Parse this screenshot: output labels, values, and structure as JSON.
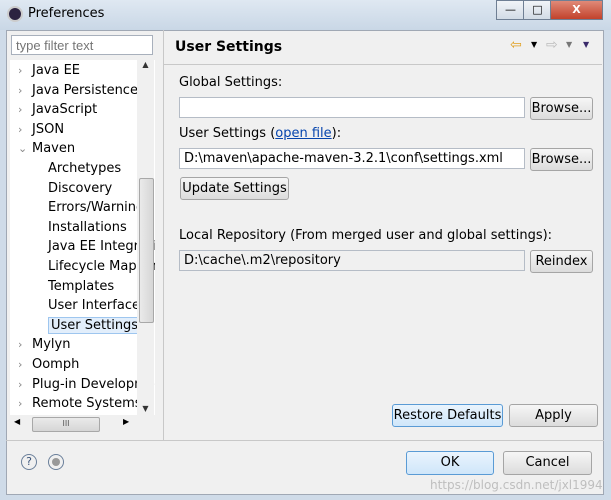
{
  "window": {
    "title": "Preferences",
    "minimize": "—",
    "maximize": "□",
    "close": "X"
  },
  "filter": {
    "placeholder": "type filter text"
  },
  "tree": {
    "items": [
      {
        "label": "Java EE",
        "level": 0
      },
      {
        "label": "Java Persistence",
        "level": 0
      },
      {
        "label": "JavaScript",
        "level": 0
      },
      {
        "label": "JSON",
        "level": 0
      },
      {
        "label": "Maven",
        "level": 0,
        "expanded": true
      },
      {
        "label": "Archetypes",
        "level": 1
      },
      {
        "label": "Discovery",
        "level": 1
      },
      {
        "label": "Errors/Warnings",
        "level": 1
      },
      {
        "label": "Installations",
        "level": 1
      },
      {
        "label": "Java EE Integration",
        "level": 1
      },
      {
        "label": "Lifecycle Mappings",
        "level": 1
      },
      {
        "label": "Templates",
        "level": 1
      },
      {
        "label": "User Interface",
        "level": 1
      },
      {
        "label": "User Settings",
        "level": 1,
        "selected": true
      },
      {
        "label": "Mylyn",
        "level": 0
      },
      {
        "label": "Oomph",
        "level": 0
      },
      {
        "label": "Plug-in Development",
        "level": 0
      },
      {
        "label": "Remote Systems",
        "level": 0
      }
    ]
  },
  "page": {
    "title": "User Settings",
    "global_label": "Global Settings:",
    "global_value": "",
    "browse": "Browse...",
    "user_label_pre": "User Settings (",
    "open_file": "open file",
    "user_label_post": "):",
    "user_value": "D:\\maven\\apache-maven-3.2.1\\conf\\settings.xml",
    "update": "Update Settings",
    "local_label": "Local Repository (From merged user and global settings):",
    "local_value": "D:\\cache\\.m2\\repository",
    "reindex": "Reindex",
    "restore": "Restore Defaults",
    "apply": "Apply"
  },
  "footer": {
    "help": "?",
    "ok": "OK",
    "cancel": "Cancel"
  },
  "watermark": "https://blog.csdn.net/jxl1994"
}
